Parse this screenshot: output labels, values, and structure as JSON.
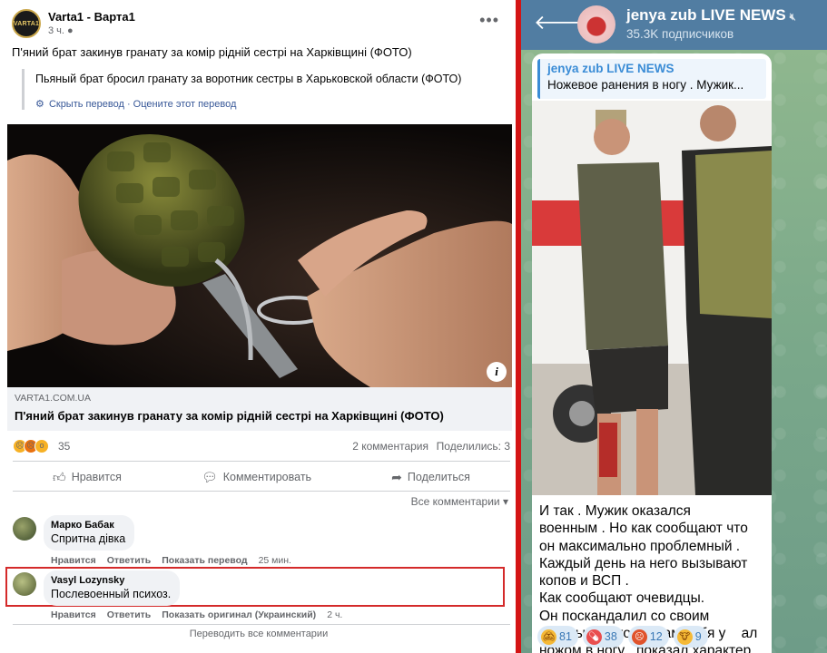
{
  "facebook": {
    "page_name": "Varta1 - Варта1",
    "avatar_text": "VARTA1",
    "time": "3 ч.",
    "post_text": "П'яний брат закинув гранату за комір рідній сестрі на Харківщині (ФОТО)",
    "translation": "Пьяный брат бросил гранату за воротник сестры в Харьковской области (ФОТО)",
    "hide_translation": "Скрыть перевод",
    "rate_translation": "Оцените этот перевод",
    "link_domain": "VARTA1.COM.UA",
    "link_title": "П'яний брат закинув гранату за комір рідній сестрі на Харківщині (ФОТО)",
    "reactions_count": "35",
    "comments_count": "2 комментария",
    "shares_count": "Поделились: 3",
    "actions": {
      "like": "Нравится",
      "comment": "Комментировать",
      "share": "Поделиться"
    },
    "all_comments": "Все комментарии",
    "comments": [
      {
        "name": "Марко Бабак",
        "text": "Спритна дівка",
        "like": "Нравится",
        "reply": "Ответить",
        "translate": "Показать перевод",
        "time": "25 мин."
      },
      {
        "name": "Vasyl Lozynsky",
        "text": "Послевоенный психоз.",
        "like": "Нравится",
        "reply": "Ответить",
        "translate": "Показать оригинал (Украинский)",
        "time": "2 ч."
      }
    ],
    "translate_all": "Переводить все комментарии"
  },
  "telegram": {
    "channel_name": "jenya zub LIVE NEWS",
    "subscribers": "35.3K подписчиков",
    "reply_title": "jenya zub LIVE NEWS",
    "reply_text": "Ножевое ранения в ногу . Мужик...",
    "message": "И так .  Мужик оказался\nвоенным . Но как сообщают что\nон максимально проблемный .\nКаждый день на него вызывают\nкопов и ВСП .\nКак сообщают очевидцы.\nОн поскандалил со своим\nсобутыльником и сам себя у    ал\nножом в ногу , показал характер\nтак сказать",
    "reactions": [
      {
        "icon": "monkey-icon",
        "count": "81"
      },
      {
        "icon": "pill-icon",
        "count": "38"
      },
      {
        "icon": "angry-icon",
        "count": "12"
      },
      {
        "icon": "cow-icon",
        "count": "9"
      }
    ]
  }
}
